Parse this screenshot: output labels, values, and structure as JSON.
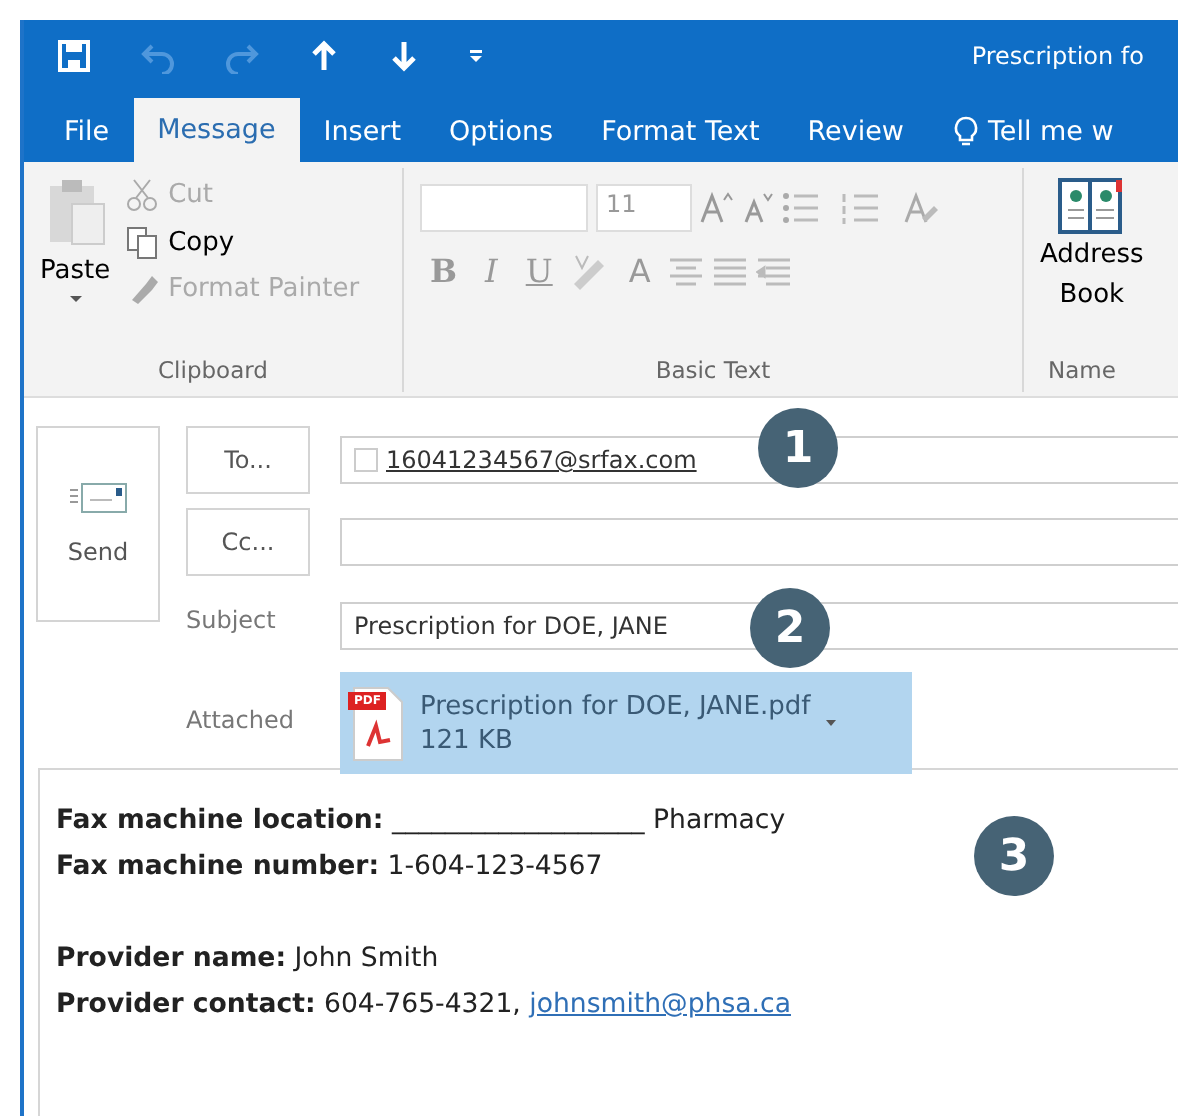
{
  "window": {
    "title": "Prescription fo"
  },
  "quick_access": [
    {
      "kind": "save",
      "disabled": false
    },
    {
      "kind": "undo",
      "disabled": true
    },
    {
      "kind": "redo",
      "disabled": true
    },
    {
      "kind": "up",
      "disabled": false
    },
    {
      "kind": "down",
      "disabled": false
    },
    {
      "kind": "customize",
      "disabled": false
    }
  ],
  "tabs": [
    {
      "label": "File",
      "selected": false
    },
    {
      "label": "Message",
      "selected": true
    },
    {
      "label": "Insert",
      "selected": false
    },
    {
      "label": "Options",
      "selected": false
    },
    {
      "label": "Format Text",
      "selected": false
    },
    {
      "label": "Review",
      "selected": false
    }
  ],
  "tell_me": "Tell me w",
  "ribbon": {
    "clipboard": {
      "label": "Clipboard",
      "paste": "Paste",
      "items": [
        {
          "kind": "cut",
          "label": "Cut",
          "disabled": true
        },
        {
          "kind": "copy",
          "label": "Copy",
          "disabled": false
        },
        {
          "kind": "painter",
          "label": "Format Painter",
          "disabled": true
        }
      ]
    },
    "basic_text": {
      "label": "Basic Text",
      "font_size": "11",
      "format_buttons": [
        "B",
        "I",
        "U"
      ],
      "font_color": "A"
    },
    "names": {
      "label": "Name",
      "address_book": "Address Book"
    }
  },
  "compose": {
    "send": "Send",
    "to_button": "To...",
    "cc_button": "Cc...",
    "to_checked": false,
    "to_value": "16041234567@srfax.com",
    "subject_label": "Subject",
    "subject_value": "Prescription for DOE, JANE",
    "attached_label": "Attached",
    "attachment": {
      "icon_label": "PDF",
      "name": "Prescription for DOE, JANE.pdf",
      "size": "121 KB"
    }
  },
  "body": [
    [
      {
        "text": "**Fax machine location:** ___________________ Pharmacy"
      },
      {
        "text": "**Fax machine number:** 1-604-123-4567"
      }
    ],
    [
      {
        "text": "**Provider name:** John Smith"
      },
      {
        "text": "**Provider contact:** 604-765-4321, ",
        "link": "johnsmith@phsa.ca"
      }
    ]
  ],
  "callouts": [
    {
      "number": "1"
    },
    {
      "number": "2"
    },
    {
      "number": "3"
    }
  ]
}
